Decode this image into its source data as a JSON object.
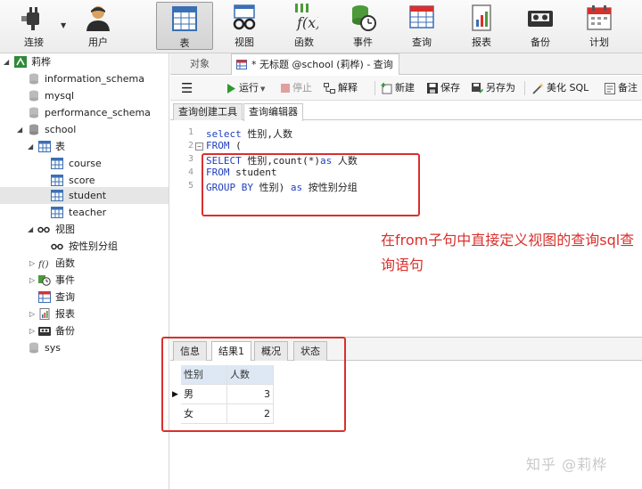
{
  "toolbar": {
    "buttons": [
      {
        "label": "连接",
        "icon": "plug-icon"
      },
      {
        "label": "用户",
        "icon": "user-icon"
      },
      {
        "label": "表",
        "icon": "table-icon"
      },
      {
        "label": "视图",
        "icon": "glasses-icon"
      },
      {
        "label": "函数",
        "icon": "function-icon"
      },
      {
        "label": "事件",
        "icon": "event-clock-icon"
      },
      {
        "label": "查询",
        "icon": "query-table-icon"
      },
      {
        "label": "报表",
        "icon": "report-icon"
      },
      {
        "label": "备份",
        "icon": "tape-icon"
      },
      {
        "label": "计划",
        "icon": "calendar-icon"
      }
    ]
  },
  "tree": {
    "connection": "莉桦",
    "databases": [
      "information_schema",
      "mysql",
      "performance_schema",
      "school",
      "sys"
    ],
    "groups": {
      "tables": "表",
      "views": "视图",
      "functions": "函数",
      "events": "事件",
      "queries": "查询",
      "reports": "报表",
      "backups": "备份"
    },
    "tables": [
      "course",
      "score",
      "student",
      "teacher"
    ],
    "views": [
      "按性别分组"
    ],
    "selected_table": "student"
  },
  "tabs": {
    "objects": "对象",
    "query_title": "* 无标题 @school (莉桦) - 查询"
  },
  "query_toolbar": {
    "menu_icon": "hamburger-icon",
    "run": "运行",
    "stop": "停止",
    "explain": "解释",
    "new": "新建",
    "save": "保存",
    "save_as": "另存为",
    "beautify": "美化 SQL",
    "comment": "备注"
  },
  "subtabs": {
    "builder": "查询创建工具",
    "editor": "查询编辑器"
  },
  "editor": {
    "line_numbers": [
      "1",
      "2",
      "3",
      "4",
      "5"
    ],
    "line1": {
      "kw1": "select",
      "rest": " 性别,人数"
    },
    "line2": {
      "kw1": "FROM",
      "rest": " ("
    },
    "line3": {
      "kw1": "SELECT",
      "mid": " 性别,count(*)",
      "kw2": "as",
      "rest": " 人数"
    },
    "line4": {
      "kw1": "FROM",
      "rest": " student"
    },
    "line5": {
      "kw1": "GROUP BY",
      "mid": " 性别) ",
      "kw2": "as",
      "rest": " 按性别分组"
    }
  },
  "annotation": "在from子句中直接定义视图的查询sql查询语句",
  "result": {
    "tabs": [
      "信息",
      "结果1",
      "概况",
      "状态"
    ],
    "active_tab": "结果1",
    "columns": [
      "性别",
      "人数"
    ],
    "rows": [
      [
        "男",
        "3"
      ],
      [
        "女",
        "2"
      ]
    ]
  },
  "watermark": "知乎 @莉桦",
  "colors": {
    "keyword": "#1f3fbf",
    "annotation_red": "#d9302c",
    "header_bg": "#dde8f4"
  }
}
